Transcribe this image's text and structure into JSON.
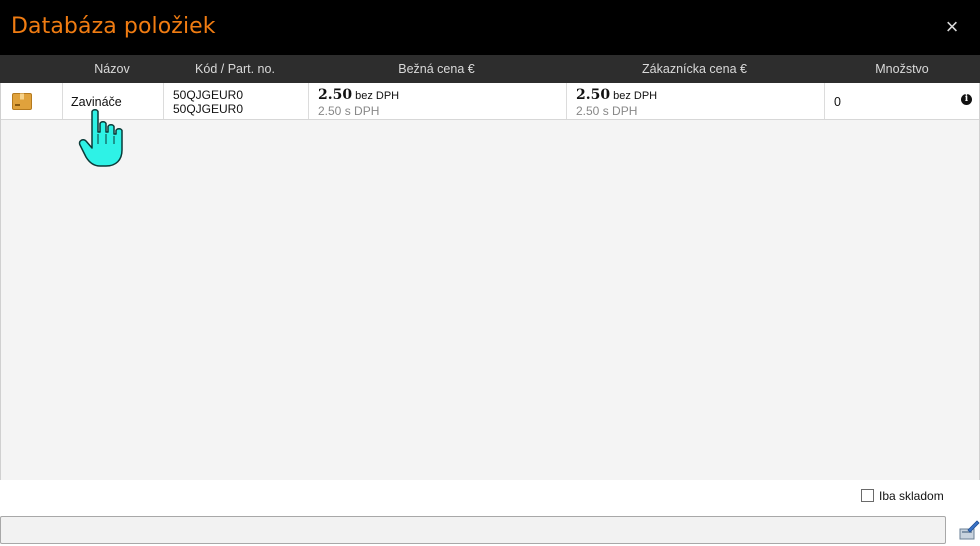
{
  "window": {
    "title": "Databáza položiek",
    "close_label": "×"
  },
  "columns": [
    "Názov",
    "Kód / Part. no.",
    "Bežná cena €",
    "Zákaznícka cena €",
    "Množstvo"
  ],
  "rows": [
    {
      "icon": "package-icon",
      "name": "Zavináče",
      "code": "50QJGEUR0",
      "part_no": "50QJGEUR0",
      "regular_price": {
        "net": "2.50",
        "net_label": "bez DPH",
        "gross": "2.50",
        "gross_label": "s DPH"
      },
      "customer_price": {
        "net": "2.50",
        "net_label": "bez DPH",
        "gross": "2.50",
        "gross_label": "s DPH"
      },
      "quantity": "0",
      "info_icon": "info-icon"
    }
  ],
  "footer": {
    "in_stock_only_label": "Iba skladom",
    "in_stock_only_checked": false,
    "search_value": "",
    "search_placeholder": ""
  },
  "colors": {
    "title_accent": "#f07c12",
    "titlebar_bg": "#000000",
    "header_bg": "#2d2d2d",
    "cursor": "#2ef2e6"
  }
}
